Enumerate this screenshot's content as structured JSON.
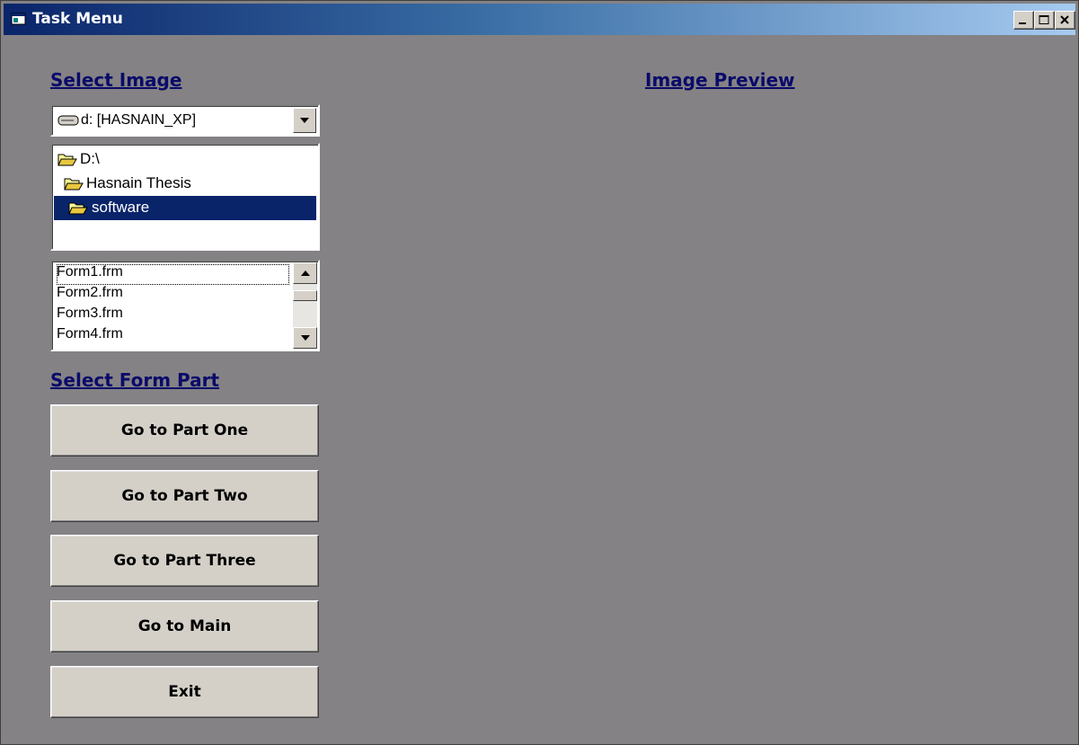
{
  "window": {
    "title": "Task Menu",
    "controls": [
      "minimize-icon",
      "maximize-icon",
      "close-icon"
    ]
  },
  "select_image": {
    "heading": "Select Image",
    "drive": {
      "value": "d: [HASNAIN_XP]",
      "icon": "drive-icon"
    },
    "directories": [
      {
        "label": "D:\\",
        "icon": "open-folder-icon",
        "selected": false
      },
      {
        "label": "Hasnain Thesis",
        "icon": "open-folder-icon",
        "selected": false
      },
      {
        "label": "software",
        "icon": "open-folder-icon",
        "selected": true
      }
    ],
    "files": [
      "Form1.frm",
      "Form2.frm",
      "Form3.frm",
      "Form4.frm"
    ],
    "file_scroll_position": 0.2
  },
  "preview": {
    "heading": "Image Preview"
  },
  "form_part": {
    "heading": "Select Form Part",
    "buttons": [
      "Go to Part One",
      "Go to Part Two",
      "Go to Part Three",
      "Go to Main",
      "Exit"
    ]
  },
  "colors": {
    "form_background": "#848284",
    "button_face": "#d4d0c8",
    "selection": "#0a246a",
    "heading_text": "#0a0a6a"
  }
}
